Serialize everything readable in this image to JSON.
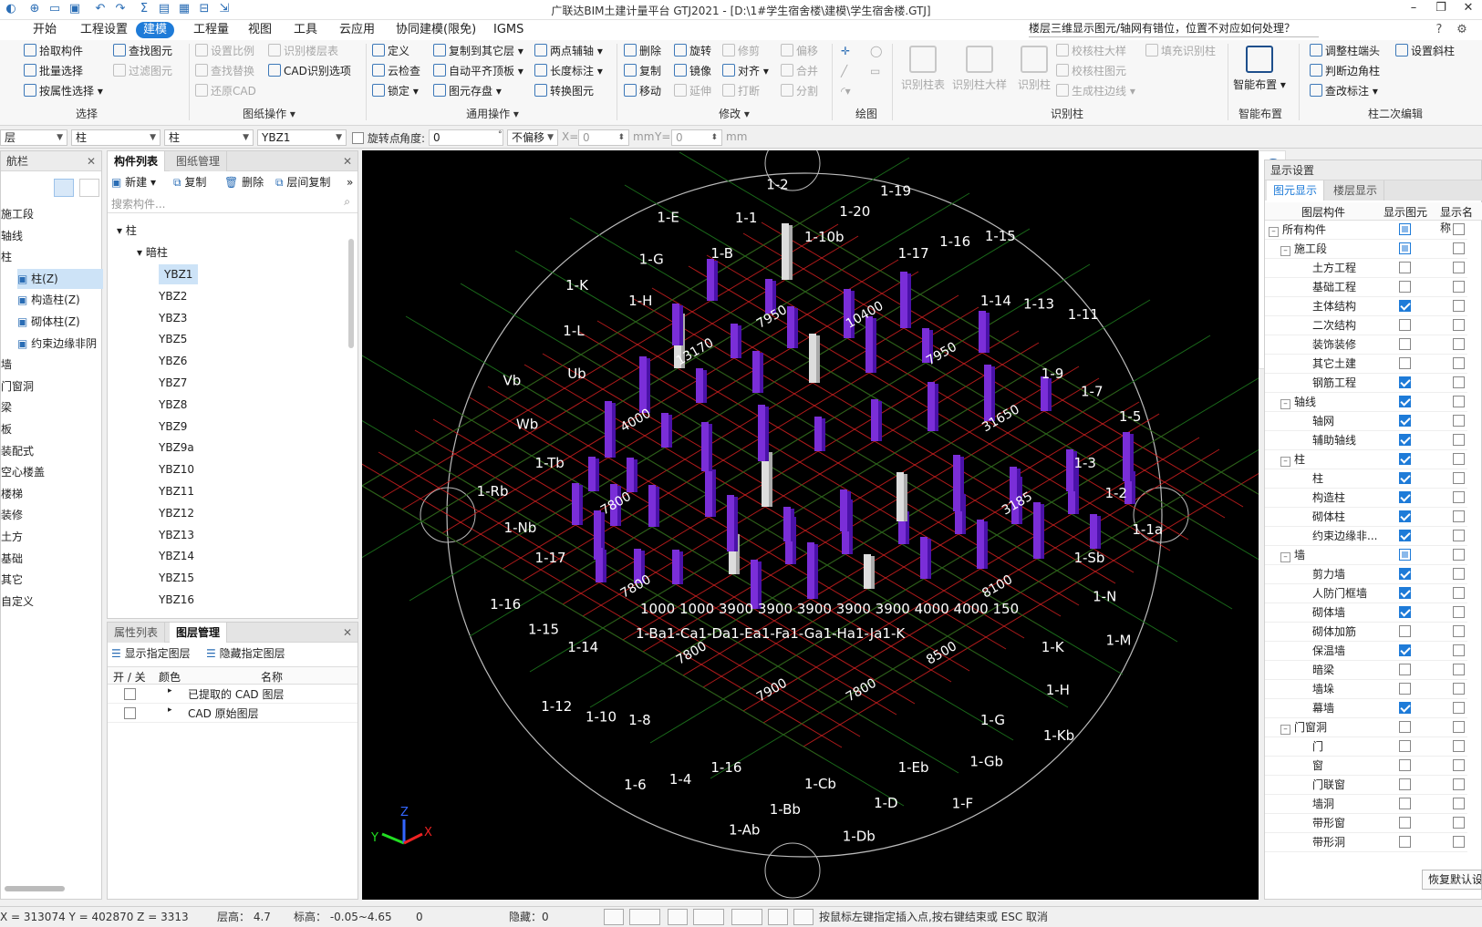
{
  "titlebar": {
    "title": "广联达BIM土建计量平台 GTJ2021 - [D:\\1#学生宿舍楼\\建模\\学生宿舍楼.GTJ]"
  },
  "menubar": {
    "items": [
      "开始",
      "工程设置",
      "建模",
      "工程量",
      "视图",
      "工具",
      "云应用",
      "协同建模(限免)",
      "IGMS"
    ],
    "active": "建模",
    "search": "楼层三维显示图元/轴网有错位，位置不对应如何处理？"
  },
  "ribbon": {
    "select": {
      "pick": "拾取构件",
      "batch": "批量选择",
      "by_attr": "按属性选择",
      "find": "查找图元",
      "filter": "过滤图元",
      "group": "选择"
    },
    "drawing_ops": {
      "set_scale": "设置比例",
      "recog_floor": "识别楼层表",
      "find_replace": "查找替换",
      "cad_options": "CAD识别选项",
      "restore_cad": "还原CAD",
      "group": "图纸操作"
    },
    "general_ops": {
      "define": "定义",
      "copy_to_floor": "复制到其它层",
      "two_point_aux": "两点辅轴",
      "cloud_check": "云检查",
      "auto_flush": "自动平齐顶板",
      "length_mark": "长度标注",
      "lock": "锁定",
      "save_element": "图元存盘",
      "convert": "转换图元",
      "group": "通用操作"
    },
    "modify": {
      "delete": "删除",
      "rotate": "旋转",
      "trim": "修剪",
      "offset": "偏移",
      "copy": "复制",
      "mirror": "镜像",
      "align": "对齐",
      "merge": "合并",
      "move": "移动",
      "extend": "延伸",
      "break": "打断",
      "split": "分割",
      "group": "修改"
    },
    "draw": {
      "group": "绘图"
    },
    "recognize_col": {
      "col_table": "识别柱表",
      "col_detail": "识别柱大样",
      "recog_col": "识别柱",
      "check_detail": "校核柱大样",
      "check_elem": "校核柱图元",
      "gen_edge": "生成柱边线",
      "fill_recog": "填充识别柱",
      "group": "识别柱"
    },
    "smart": {
      "smart_place": "智能布置",
      "group": "智能布置"
    },
    "col_edit": {
      "adjust_head": "调整柱端头",
      "set_slope": "设置斜柱",
      "judge_corner": "判断边角柱",
      "check_mark": "查改标注",
      "group": "柱二次编辑"
    }
  },
  "propbar": {
    "floor": "层",
    "type1": "柱",
    "type2": "柱",
    "element": "YBZ1",
    "rotate_pt": "旋转点",
    "angle_label": "角度:",
    "angle": "0",
    "offset_mode": "不偏移",
    "x_label": "X=",
    "x_val": "0",
    "mm1": "mm",
    "y_label": "Y=",
    "y_val": "0",
    "mm2": "mm"
  },
  "nav": {
    "title": "航栏",
    "items": [
      "施工段",
      "轴线",
      "柱",
      "柱(Z)",
      "构造柱(Z)",
      "砌体柱(Z)",
      "约束边缘非阴",
      "墙",
      "门窗洞",
      "梁",
      "板",
      "装配式",
      "空心楼盖",
      "楼梯",
      "装修",
      "土方",
      "基础",
      "其它",
      "自定义"
    ]
  },
  "comp_panel": {
    "tabs": [
      "构件列表",
      "图纸管理"
    ],
    "toolbar": {
      "new": "新建",
      "copy": "复制",
      "delete": "删除",
      "floor_copy": "层间复制"
    },
    "search_placeholder": "搜索构件...",
    "tree_root": "柱",
    "tree_sub": "暗柱",
    "items": [
      "YBZ1",
      "YBZ2",
      "YBZ3",
      "YBZ5",
      "YBZ6",
      "YBZ7",
      "YBZ8",
      "YBZ9",
      "YBZ9a",
      "YBZ10",
      "YBZ11",
      "YBZ12",
      "YBZ13",
      "YBZ14",
      "YBZ15",
      "YBZ16"
    ],
    "selected": "YBZ1"
  },
  "layer_panel": {
    "tabs": [
      "属性列表",
      "图层管理"
    ],
    "show_layer": "显示指定图层",
    "hide_layer": "隐藏指定图层",
    "headers": [
      "开 / 关",
      "颜色",
      "名称"
    ],
    "rows": [
      "已提取的 CAD 图层",
      "CAD 原始图层"
    ]
  },
  "display_panel": {
    "title": "显示设置",
    "tabs": [
      "图元显示",
      "楼层显示"
    ],
    "headers": [
      "图层构件",
      "显示图元",
      "显示名称"
    ],
    "rows": [
      {
        "name": "所有构件",
        "level": 0,
        "group": true,
        "show": "part"
      },
      {
        "name": "施工段",
        "level": 1,
        "group": true,
        "show": "part"
      },
      {
        "name": "土方工程",
        "level": 2,
        "show": "off"
      },
      {
        "name": "基础工程",
        "level": 2,
        "show": "off"
      },
      {
        "name": "主体结构",
        "level": 2,
        "show": "on"
      },
      {
        "name": "二次结构",
        "level": 2,
        "show": "off"
      },
      {
        "name": "装饰装修",
        "level": 2,
        "show": "off"
      },
      {
        "name": "其它土建",
        "level": 2,
        "show": "off"
      },
      {
        "name": "钢筋工程",
        "level": 2,
        "show": "on"
      },
      {
        "name": "轴线",
        "level": 1,
        "group": true,
        "show": "on"
      },
      {
        "name": "轴网",
        "level": 2,
        "show": "on"
      },
      {
        "name": "辅助轴线",
        "level": 2,
        "show": "on"
      },
      {
        "name": "柱",
        "level": 1,
        "group": true,
        "show": "on"
      },
      {
        "name": "柱",
        "level": 2,
        "show": "on"
      },
      {
        "name": "构造柱",
        "level": 2,
        "show": "on"
      },
      {
        "name": "砌体柱",
        "level": 2,
        "show": "on"
      },
      {
        "name": "约束边缘非...",
        "level": 2,
        "show": "on"
      },
      {
        "name": "墙",
        "level": 1,
        "group": true,
        "show": "part"
      },
      {
        "name": "剪力墙",
        "level": 2,
        "show": "on"
      },
      {
        "name": "人防门框墙",
        "level": 2,
        "show": "on"
      },
      {
        "name": "砌体墙",
        "level": 2,
        "show": "on"
      },
      {
        "name": "砌体加筋",
        "level": 2,
        "show": "off"
      },
      {
        "name": "保温墙",
        "level": 2,
        "show": "on"
      },
      {
        "name": "暗梁",
        "level": 2,
        "show": "off"
      },
      {
        "name": "墙垛",
        "level": 2,
        "show": "off"
      },
      {
        "name": "幕墙",
        "level": 2,
        "show": "on"
      },
      {
        "name": "门窗洞",
        "level": 1,
        "group": true,
        "show": "off"
      },
      {
        "name": "门",
        "level": 2,
        "show": "off"
      },
      {
        "name": "窗",
        "level": 2,
        "show": "off"
      },
      {
        "name": "门联窗",
        "level": 2,
        "show": "off"
      },
      {
        "name": "墙洞",
        "level": 2,
        "show": "off"
      },
      {
        "name": "带形窗",
        "level": 2,
        "show": "off"
      },
      {
        "name": "带形洞",
        "level": 2,
        "show": "off"
      }
    ],
    "restore": "恢复默认设"
  },
  "viewport": {
    "axis_labels": [
      "1-10b",
      "1-20",
      "1-19",
      "1-17",
      "1-16",
      "1-15",
      "1-14",
      "1-13",
      "1-11",
      "1-9",
      "1-7",
      "1-5",
      "1-3",
      "1-2",
      "1-1a",
      "1-Sb",
      "1-N",
      "1-M",
      "1-K",
      "1-H",
      "1-Kb",
      "1-G",
      "1-Gb",
      "1-F",
      "1-Eb",
      "1-D",
      "1-Db",
      "1-Cb",
      "1-Bb",
      "1-Ab",
      "1-16",
      "1-4",
      "1-6",
      "1-8",
      "1-10",
      "1-12",
      "1-14",
      "1-15",
      "1-16",
      "1-17",
      "1-Nb",
      "1-Rb",
      "1-Tb",
      "Wb",
      "Vb",
      "Ub",
      "1-L",
      "1-K",
      "1-H",
      "1-G",
      "1-E",
      "1-B",
      "1-1",
      "1-2"
    ],
    "dims": [
      "3185",
      "8100",
      "8500",
      "7800",
      "7900",
      "7800",
      "7800",
      "7800",
      "4000",
      "13170",
      "7950",
      "10400",
      "7950",
      "31650"
    ],
    "bottom_row": "1-Ba1-Ca1-Da1-Ea1-Fa1-Ga1-Ha1-Ja1-K",
    "bottom_dims": "1000 1000 3900 3900 3900 3900 3900 4000 4000 150",
    "gizmo": [
      "Y",
      "Z",
      "X"
    ]
  },
  "statusbar": {
    "coords": "X = 313074 Y = 402870 Z = 3313",
    "floor_height": "层高： 4.7",
    "elevation": "标高： -0.05~4.65",
    "count": "0",
    "hidden": "隐藏：0",
    "hint": "按鼠标左键指定插入点,按右键结束或 ESC 取消"
  }
}
